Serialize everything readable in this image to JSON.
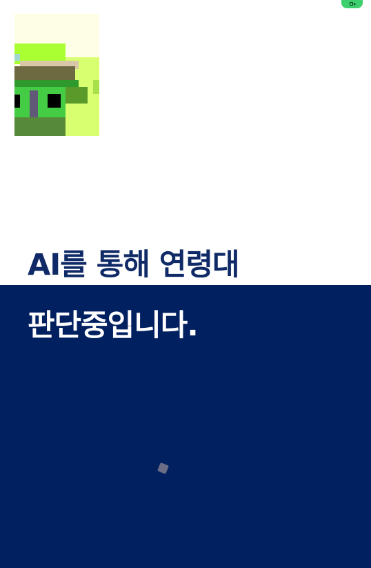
{
  "colors": {
    "accent_navy": "#002060",
    "heading_navy": "#0f2a66",
    "status_green": "#3ecf6e",
    "background": "#ffffff"
  },
  "status_bar": {
    "indicator_icon": "camera-recording-icon"
  },
  "camera_preview": {
    "description_icon": "camera-feed-thumbnail"
  },
  "headline": {
    "line1": "AI를 통해 연령대",
    "line2": "판단중입니다."
  },
  "loader": {
    "icon": "loading-spinner-icon"
  }
}
